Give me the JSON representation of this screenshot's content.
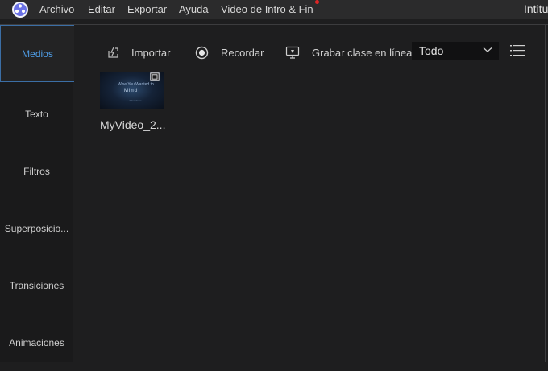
{
  "menubar": {
    "logo_icon": "app-logo-icon",
    "items": [
      "Archivo",
      "Editar",
      "Exportar",
      "Ayuda",
      "Video de Intro & Fin"
    ],
    "window_title": "Intitu"
  },
  "sidebar": {
    "tabs": [
      {
        "label": "Medios",
        "active": true
      },
      {
        "label": "Texto",
        "active": false
      },
      {
        "label": "Filtros",
        "active": false
      },
      {
        "label": "Superposicio...",
        "active": false
      },
      {
        "label": "Transiciones",
        "active": false
      },
      {
        "label": "Animaciones",
        "active": false
      }
    ]
  },
  "toolbar": {
    "import_label": "Importar",
    "import_icon": "import-icon",
    "record_label": "Recordar",
    "record_icon": "record-icon",
    "online_class_label": "Grabar clase en línea",
    "online_class_icon": "screen-record-icon",
    "filter_value": "Todo",
    "list_icon": "list-view-icon"
  },
  "media": {
    "items": [
      {
        "name": "MyVideo_2...",
        "thumb_line1": "Wow You Wanted to",
        "thumb_line2": "Mind",
        "thumb_line3": "video demo"
      }
    ]
  },
  "colors": {
    "accent": "#4f9ee8",
    "background": "#1e1e1f",
    "menubar": "#2b2b2c"
  }
}
